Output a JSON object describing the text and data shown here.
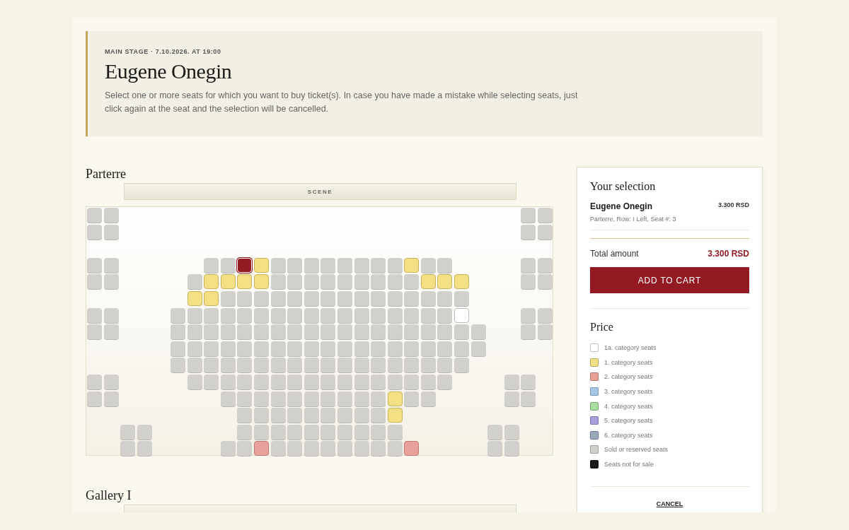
{
  "event": {
    "meta": "MAIN STAGE · 7.10.2026. AT 19:00",
    "title": "Eugene Onegin",
    "description": "Select one or more seats for which you want to buy ticket(s). In case you have made a mistake while selecting seats, just click again at the seat and the selection will be cancelled."
  },
  "sections": [
    {
      "name": "Parterre",
      "scene": "SCENE",
      "rows": [
        {
          "seats": [
            {
              "kind": "sold"
            },
            {
              "kind": "sold"
            },
            {
              "kind": "gap"
            },
            {
              "kind": "gap"
            },
            {
              "kind": "gap"
            },
            {
              "kind": "gap"
            },
            {
              "kind": "gap"
            },
            {
              "kind": "gap"
            },
            {
              "kind": "gap"
            },
            {
              "kind": "gap"
            },
            {
              "kind": "gap"
            },
            {
              "kind": "gap"
            },
            {
              "kind": "gap"
            },
            {
              "kind": "gap"
            },
            {
              "kind": "gap"
            },
            {
              "kind": "gap"
            },
            {
              "kind": "gap"
            },
            {
              "kind": "gap"
            },
            {
              "kind": "gap"
            },
            {
              "kind": "gap"
            },
            {
              "kind": "gap"
            },
            {
              "kind": "gap"
            },
            {
              "kind": "gap"
            },
            {
              "kind": "gap"
            },
            {
              "kind": "gap"
            },
            {
              "kind": "gap"
            },
            {
              "kind": "sold"
            },
            {
              "kind": "sold"
            }
          ]
        },
        {
          "seats": [
            {
              "kind": "sold"
            },
            {
              "kind": "sold"
            },
            {
              "kind": "gap"
            },
            {
              "kind": "gap"
            },
            {
              "kind": "gap"
            },
            {
              "kind": "gap"
            },
            {
              "kind": "gap"
            },
            {
              "kind": "gap"
            },
            {
              "kind": "gap"
            },
            {
              "kind": "gap"
            },
            {
              "kind": "gap"
            },
            {
              "kind": "gap"
            },
            {
              "kind": "gap"
            },
            {
              "kind": "gap"
            },
            {
              "kind": "gap"
            },
            {
              "kind": "gap"
            },
            {
              "kind": "gap"
            },
            {
              "kind": "gap"
            },
            {
              "kind": "gap"
            },
            {
              "kind": "gap"
            },
            {
              "kind": "gap"
            },
            {
              "kind": "gap"
            },
            {
              "kind": "gap"
            },
            {
              "kind": "gap"
            },
            {
              "kind": "gap"
            },
            {
              "kind": "gap"
            },
            {
              "kind": "sold"
            },
            {
              "kind": "sold"
            }
          ]
        },
        {
          "seats": [
            {
              "kind": "gap"
            }
          ]
        },
        {
          "seats": [
            {
              "kind": "sold"
            },
            {
              "kind": "sold"
            },
            {
              "kind": "gap"
            },
            {
              "kind": "gap"
            },
            {
              "kind": "gap"
            },
            {
              "kind": "gap"
            },
            {
              "kind": "gap"
            },
            {
              "kind": "sold"
            },
            {
              "kind": "sold"
            },
            {
              "kind": "selected"
            },
            {
              "kind": "cat1"
            },
            {
              "kind": "sold"
            },
            {
              "kind": "sold"
            },
            {
              "kind": "sold"
            },
            {
              "kind": "sold"
            },
            {
              "kind": "sold"
            },
            {
              "kind": "sold"
            },
            {
              "kind": "sold"
            },
            {
              "kind": "sold"
            },
            {
              "kind": "cat1"
            },
            {
              "kind": "sold"
            },
            {
              "kind": "sold"
            },
            {
              "kind": "gap"
            },
            {
              "kind": "gap"
            },
            {
              "kind": "gap"
            },
            {
              "kind": "gap"
            },
            {
              "kind": "sold"
            },
            {
              "kind": "sold"
            }
          ]
        },
        {
          "seats": [
            {
              "kind": "sold"
            },
            {
              "kind": "sold"
            },
            {
              "kind": "gap"
            },
            {
              "kind": "gap"
            },
            {
              "kind": "gap"
            },
            {
              "kind": "gap"
            },
            {
              "kind": "sold"
            },
            {
              "kind": "cat1"
            },
            {
              "kind": "cat1"
            },
            {
              "kind": "cat1"
            },
            {
              "kind": "cat1"
            },
            {
              "kind": "sold"
            },
            {
              "kind": "sold"
            },
            {
              "kind": "sold"
            },
            {
              "kind": "sold"
            },
            {
              "kind": "sold"
            },
            {
              "kind": "sold"
            },
            {
              "kind": "sold"
            },
            {
              "kind": "sold"
            },
            {
              "kind": "sold"
            },
            {
              "kind": "cat1"
            },
            {
              "kind": "cat1"
            },
            {
              "kind": "cat1"
            },
            {
              "kind": "gap"
            },
            {
              "kind": "gap"
            },
            {
              "kind": "gap"
            },
            {
              "kind": "sold"
            },
            {
              "kind": "sold"
            }
          ]
        },
        {
          "seats": [
            {
              "kind": "gap"
            },
            {
              "kind": "gap"
            },
            {
              "kind": "gap"
            },
            {
              "kind": "gap"
            },
            {
              "kind": "gap"
            },
            {
              "kind": "gap"
            },
            {
              "kind": "cat1"
            },
            {
              "kind": "cat1"
            },
            {
              "kind": "sold"
            },
            {
              "kind": "sold"
            },
            {
              "kind": "sold"
            },
            {
              "kind": "sold"
            },
            {
              "kind": "sold"
            },
            {
              "kind": "sold"
            },
            {
              "kind": "sold"
            },
            {
              "kind": "sold"
            },
            {
              "kind": "sold"
            },
            {
              "kind": "sold"
            },
            {
              "kind": "sold"
            },
            {
              "kind": "sold"
            },
            {
              "kind": "sold"
            },
            {
              "kind": "sold"
            },
            {
              "kind": "sold"
            }
          ]
        },
        {
          "seats": [
            {
              "kind": "sold"
            },
            {
              "kind": "sold"
            },
            {
              "kind": "gap"
            },
            {
              "kind": "gap"
            },
            {
              "kind": "gap"
            },
            {
              "kind": "sold"
            },
            {
              "kind": "sold"
            },
            {
              "kind": "sold"
            },
            {
              "kind": "sold"
            },
            {
              "kind": "sold"
            },
            {
              "kind": "sold"
            },
            {
              "kind": "sold"
            },
            {
              "kind": "sold"
            },
            {
              "kind": "sold"
            },
            {
              "kind": "sold"
            },
            {
              "kind": "sold"
            },
            {
              "kind": "sold"
            },
            {
              "kind": "sold"
            },
            {
              "kind": "sold"
            },
            {
              "kind": "sold"
            },
            {
              "kind": "sold"
            },
            {
              "kind": "sold"
            },
            {
              "kind": "cat1a"
            },
            {
              "kind": "gap"
            },
            {
              "kind": "gap"
            },
            {
              "kind": "gap"
            },
            {
              "kind": "sold"
            },
            {
              "kind": "sold"
            }
          ]
        },
        {
          "seats": [
            {
              "kind": "sold"
            },
            {
              "kind": "sold"
            },
            {
              "kind": "gap"
            },
            {
              "kind": "gap"
            },
            {
              "kind": "gap"
            },
            {
              "kind": "sold"
            },
            {
              "kind": "sold"
            },
            {
              "kind": "sold"
            },
            {
              "kind": "sold"
            },
            {
              "kind": "sold"
            },
            {
              "kind": "sold"
            },
            {
              "kind": "sold"
            },
            {
              "kind": "sold"
            },
            {
              "kind": "sold"
            },
            {
              "kind": "sold"
            },
            {
              "kind": "sold"
            },
            {
              "kind": "sold"
            },
            {
              "kind": "sold"
            },
            {
              "kind": "sold"
            },
            {
              "kind": "sold"
            },
            {
              "kind": "sold"
            },
            {
              "kind": "sold"
            },
            {
              "kind": "sold"
            },
            {
              "kind": "sold"
            },
            {
              "kind": "gap"
            },
            {
              "kind": "gap"
            },
            {
              "kind": "sold"
            },
            {
              "kind": "sold"
            }
          ]
        },
        {
          "seats": [
            {
              "kind": "gap"
            },
            {
              "kind": "gap"
            },
            {
              "kind": "gap"
            },
            {
              "kind": "gap"
            },
            {
              "kind": "gap"
            },
            {
              "kind": "sold"
            },
            {
              "kind": "sold"
            },
            {
              "kind": "sold"
            },
            {
              "kind": "sold"
            },
            {
              "kind": "sold"
            },
            {
              "kind": "sold"
            },
            {
              "kind": "sold"
            },
            {
              "kind": "sold"
            },
            {
              "kind": "sold"
            },
            {
              "kind": "sold"
            },
            {
              "kind": "sold"
            },
            {
              "kind": "sold"
            },
            {
              "kind": "sold"
            },
            {
              "kind": "sold"
            },
            {
              "kind": "sold"
            },
            {
              "kind": "sold"
            },
            {
              "kind": "sold"
            },
            {
              "kind": "sold"
            },
            {
              "kind": "sold"
            }
          ]
        },
        {
          "seats": [
            {
              "kind": "gap"
            },
            {
              "kind": "gap"
            },
            {
              "kind": "gap"
            },
            {
              "kind": "gap"
            },
            {
              "kind": "gap"
            },
            {
              "kind": "sold"
            },
            {
              "kind": "sold"
            },
            {
              "kind": "sold"
            },
            {
              "kind": "sold"
            },
            {
              "kind": "sold"
            },
            {
              "kind": "sold"
            },
            {
              "kind": "sold"
            },
            {
              "kind": "sold"
            },
            {
              "kind": "sold"
            },
            {
              "kind": "sold"
            },
            {
              "kind": "sold"
            },
            {
              "kind": "sold"
            },
            {
              "kind": "sold"
            },
            {
              "kind": "sold"
            },
            {
              "kind": "sold"
            },
            {
              "kind": "sold"
            },
            {
              "kind": "sold"
            },
            {
              "kind": "sold"
            }
          ]
        },
        {
          "seats": [
            {
              "kind": "sold"
            },
            {
              "kind": "sold"
            },
            {
              "kind": "gap"
            },
            {
              "kind": "gap"
            },
            {
              "kind": "gap"
            },
            {
              "kind": "gap"
            },
            {
              "kind": "sold"
            },
            {
              "kind": "sold"
            },
            {
              "kind": "sold"
            },
            {
              "kind": "sold"
            },
            {
              "kind": "sold"
            },
            {
              "kind": "sold"
            },
            {
              "kind": "sold"
            },
            {
              "kind": "sold"
            },
            {
              "kind": "sold"
            },
            {
              "kind": "sold"
            },
            {
              "kind": "sold"
            },
            {
              "kind": "sold"
            },
            {
              "kind": "sold"
            },
            {
              "kind": "sold"
            },
            {
              "kind": "sold"
            },
            {
              "kind": "sold"
            },
            {
              "kind": "gap"
            },
            {
              "kind": "gap"
            },
            {
              "kind": "gap"
            },
            {
              "kind": "sold"
            },
            {
              "kind": "sold"
            }
          ]
        },
        {
          "seats": [
            {
              "kind": "sold"
            },
            {
              "kind": "sold"
            },
            {
              "kind": "gap"
            },
            {
              "kind": "gap"
            },
            {
              "kind": "gap"
            },
            {
              "kind": "gap"
            },
            {
              "kind": "gap"
            },
            {
              "kind": "gap"
            },
            {
              "kind": "sold"
            },
            {
              "kind": "sold"
            },
            {
              "kind": "sold"
            },
            {
              "kind": "sold"
            },
            {
              "kind": "sold"
            },
            {
              "kind": "sold"
            },
            {
              "kind": "sold"
            },
            {
              "kind": "sold"
            },
            {
              "kind": "sold"
            },
            {
              "kind": "sold"
            },
            {
              "kind": "cat1"
            },
            {
              "kind": "sold"
            },
            {
              "kind": "sold"
            },
            {
              "kind": "gap"
            },
            {
              "kind": "gap"
            },
            {
              "kind": "gap"
            },
            {
              "kind": "gap"
            },
            {
              "kind": "sold"
            },
            {
              "kind": "sold"
            }
          ]
        },
        {
          "seats": [
            {
              "kind": "gap"
            },
            {
              "kind": "gap"
            },
            {
              "kind": "gap"
            },
            {
              "kind": "gap"
            },
            {
              "kind": "gap"
            },
            {
              "kind": "gap"
            },
            {
              "kind": "gap"
            },
            {
              "kind": "gap"
            },
            {
              "kind": "gap"
            },
            {
              "kind": "sold"
            },
            {
              "kind": "sold"
            },
            {
              "kind": "sold"
            },
            {
              "kind": "sold"
            },
            {
              "kind": "sold"
            },
            {
              "kind": "sold"
            },
            {
              "kind": "sold"
            },
            {
              "kind": "sold"
            },
            {
              "kind": "sold"
            },
            {
              "kind": "cat1"
            }
          ]
        },
        {
          "seats": [
            {
              "kind": "gap"
            },
            {
              "kind": "gap"
            },
            {
              "kind": "sold"
            },
            {
              "kind": "sold"
            },
            {
              "kind": "gap"
            },
            {
              "kind": "gap"
            },
            {
              "kind": "gap"
            },
            {
              "kind": "gap"
            },
            {
              "kind": "gap"
            },
            {
              "kind": "sold"
            },
            {
              "kind": "sold"
            },
            {
              "kind": "sold"
            },
            {
              "kind": "sold"
            },
            {
              "kind": "sold"
            },
            {
              "kind": "sold"
            },
            {
              "kind": "sold"
            },
            {
              "kind": "sold"
            },
            {
              "kind": "sold"
            },
            {
              "kind": "sold"
            },
            {
              "kind": "gap"
            },
            {
              "kind": "gap"
            },
            {
              "kind": "gap"
            },
            {
              "kind": "gap"
            },
            {
              "kind": "gap"
            },
            {
              "kind": "sold"
            },
            {
              "kind": "sold"
            }
          ]
        },
        {
          "seats": [
            {
              "kind": "gap"
            },
            {
              "kind": "gap"
            },
            {
              "kind": "sold"
            },
            {
              "kind": "sold"
            },
            {
              "kind": "gap"
            },
            {
              "kind": "gap"
            },
            {
              "kind": "gap"
            },
            {
              "kind": "gap"
            },
            {
              "kind": "sold"
            },
            {
              "kind": "sold"
            },
            {
              "kind": "cat2"
            },
            {
              "kind": "sold"
            },
            {
              "kind": "sold"
            },
            {
              "kind": "sold"
            },
            {
              "kind": "sold"
            },
            {
              "kind": "sold"
            },
            {
              "kind": "sold"
            },
            {
              "kind": "sold"
            },
            {
              "kind": "sold"
            },
            {
              "kind": "cat2"
            },
            {
              "kind": "gap"
            },
            {
              "kind": "gap"
            },
            {
              "kind": "gap"
            },
            {
              "kind": "gap"
            },
            {
              "kind": "sold"
            },
            {
              "kind": "sold"
            }
          ]
        }
      ]
    },
    {
      "name": "Gallery I"
    }
  ],
  "selection": {
    "heading": "Your selection",
    "items": [
      {
        "title": "Eugene Onegin",
        "price": "3.300 RSD",
        "detail": "Parterre, Row: I Left, Seat #: 3"
      }
    ],
    "total_label": "Total amount",
    "total": "3.300 RSD",
    "button": "ADD TO CART"
  },
  "price_legend": {
    "heading": "Price",
    "items": [
      {
        "label": "1a. category seats",
        "color": "#ffffff"
      },
      {
        "label": "1. category seats",
        "color": "#f3df84"
      },
      {
        "label": "2. category seats",
        "color": "#e8a09a"
      },
      {
        "label": "3. category seats",
        "color": "#a6c8e6"
      },
      {
        "label": "4. category seats",
        "color": "#a8dba0"
      },
      {
        "label": "5. category seats",
        "color": "#a99ddc"
      },
      {
        "label": "6. category seats",
        "color": "#97a9bc"
      },
      {
        "label": "Sold or reserved seats",
        "color": "#d1d0cd"
      },
      {
        "label": "Seats not for sale",
        "color": "#1a1a1a"
      }
    ]
  },
  "cancel": "CANCEL"
}
